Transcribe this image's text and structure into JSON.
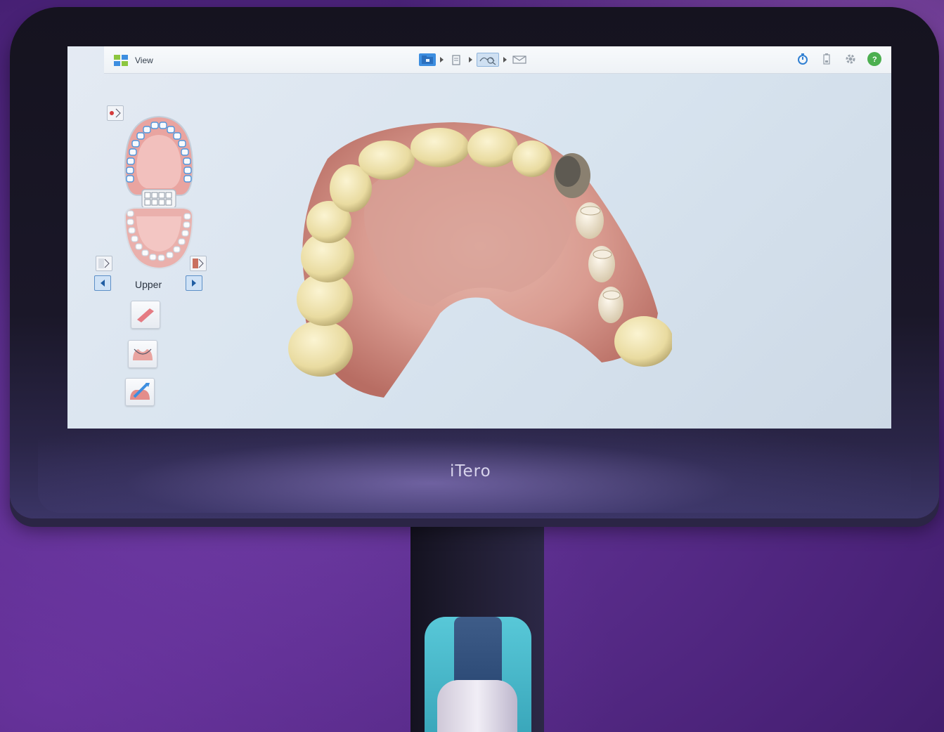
{
  "app": {
    "title": "View",
    "brand": "iTero"
  },
  "workflow": {
    "steps": [
      {
        "name": "patient-folder-icon",
        "active": false
      },
      {
        "name": "rx-clipboard-icon",
        "active": false
      },
      {
        "name": "scan-view-icon",
        "active": true
      },
      {
        "name": "send-envelope-icon",
        "active": false
      }
    ]
  },
  "toolbar_right": [
    "timer-icon",
    "battery-icon",
    "gear-icon",
    "help-icon"
  ],
  "jaw_selector": {
    "arch_label": "Upper"
  },
  "tools": [
    "eraser-tool-icon",
    "margin-tool-icon",
    "edit-tool-icon"
  ],
  "colors": {
    "accent": "#3d8ee0",
    "help": "#4caf50",
    "gum": "#e9a4a0",
    "background_purple": "#5a2d8c"
  }
}
